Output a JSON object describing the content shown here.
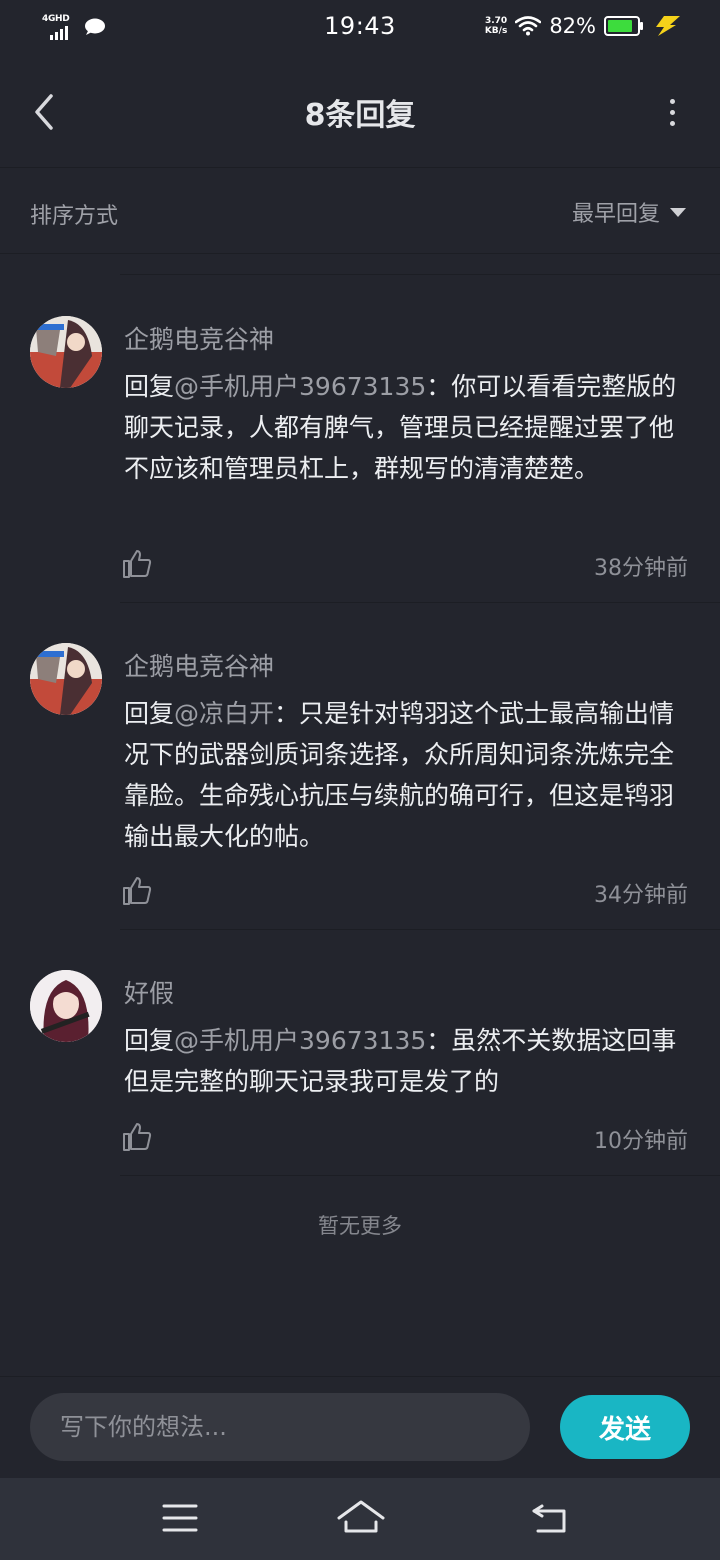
{
  "status_bar": {
    "network": "4GHD",
    "time": "19:43",
    "speed_value": "3.70",
    "speed_unit": "KB/s",
    "battery": "82%"
  },
  "header": {
    "title": "8条回复"
  },
  "sort": {
    "label": "排序方式",
    "selected": "最早回复"
  },
  "comments": [
    {
      "user": "企鹅电竞谷神",
      "reply_prefix": "回复",
      "mention": "@手机用户39673135",
      "text": "：你可以看看完整版的聊天记录，人都有脾气，管理员已经提醒过罢了他不应该和管理员杠上，群规写的清清楚楚。",
      "time": "38分钟前"
    },
    {
      "user": "企鹅电竞谷神",
      "reply_prefix": "回复",
      "mention": "@凉白开",
      "text": "：只是针对鸨羽这个武士最高输出情况下的武器剑质词条选择，众所周知词条洗炼完全靠脸。生命残心抗压与续航的确可行，但这是鸨羽输出最大化的帖。",
      "time": "34分钟前"
    },
    {
      "user": "好假",
      "reply_prefix": "回复",
      "mention": "@手机用户39673135",
      "text": "：虽然不关数据这回事但是完整的聊天记录我可是发了的",
      "time": "10分钟前"
    }
  ],
  "footer": {
    "no_more": "暂无更多"
  },
  "input": {
    "placeholder": "写下你的想法...",
    "send_label": "发送"
  },
  "colors": {
    "background": "#23252d",
    "accent": "#19b6c4",
    "battery_green": "#3ddc3d",
    "charge_yellow": "#f5d21a"
  }
}
